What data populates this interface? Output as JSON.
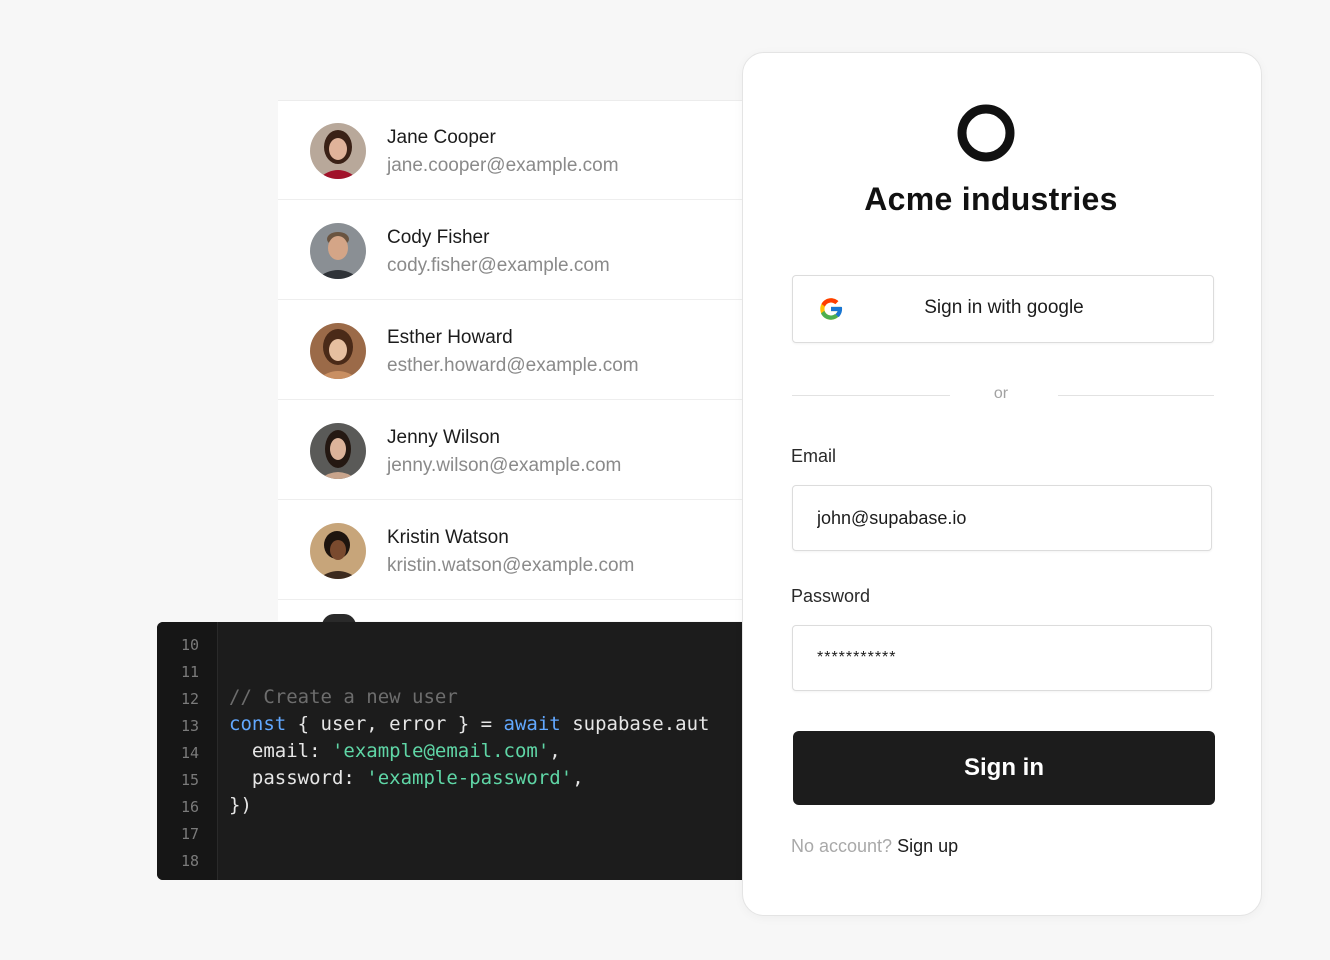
{
  "users": [
    {
      "name": "Jane Cooper",
      "email": "jane.cooper@example.com"
    },
    {
      "name": "Cody Fisher",
      "email": "cody.fisher@example.com"
    },
    {
      "name": "Esther Howard",
      "email": "esther.howard@example.com"
    },
    {
      "name": "Jenny Wilson",
      "email": "jenny.wilson@example.com"
    },
    {
      "name": "Kristin Watson",
      "email": "kristin.watson@example.com"
    }
  ],
  "code": {
    "line_numbers": [
      "10",
      "11",
      "12",
      "13",
      "14",
      "15",
      "16",
      "17",
      "18"
    ],
    "lines": [
      {
        "tokens": []
      },
      {
        "tokens": []
      },
      {
        "tokens": [
          {
            "t": "// Create a new user",
            "c": "comment"
          }
        ]
      },
      {
        "tokens": [
          {
            "t": "const",
            "c": "keyword"
          },
          {
            "t": " { user, error } = ",
            "c": "plain"
          },
          {
            "t": "await",
            "c": "keyword"
          },
          {
            "t": " supabase.aut",
            "c": "plain"
          }
        ]
      },
      {
        "tokens": [
          {
            "t": "  email: ",
            "c": "plain"
          },
          {
            "t": "'example@email.com'",
            "c": "string"
          },
          {
            "t": ",",
            "c": "plain"
          }
        ]
      },
      {
        "tokens": [
          {
            "t": "  password: ",
            "c": "plain"
          },
          {
            "t": "'example-password'",
            "c": "string"
          },
          {
            "t": ",",
            "c": "plain"
          }
        ]
      },
      {
        "tokens": [
          {
            "t": "})",
            "c": "plain"
          }
        ]
      },
      {
        "tokens": []
      },
      {
        "tokens": []
      }
    ]
  },
  "auth": {
    "brand_name": "Acme industries",
    "google_button_label": "Sign in with google",
    "divider_text": "or",
    "email_label": "Email",
    "email_value": "john@supabase.io",
    "password_label": "Password",
    "password_value": "***********",
    "signin_button_label": "Sign in",
    "signup_prompt": "No account?",
    "signup_link": "Sign up"
  },
  "colors": {
    "code_keyword": "#62a8ff",
    "code_string": "#5fd6a6",
    "code_comment": "#6d6d6d",
    "button_dark": "#1c1c1c"
  },
  "icons": [
    "google-icon",
    "acme-logo-ring"
  ]
}
